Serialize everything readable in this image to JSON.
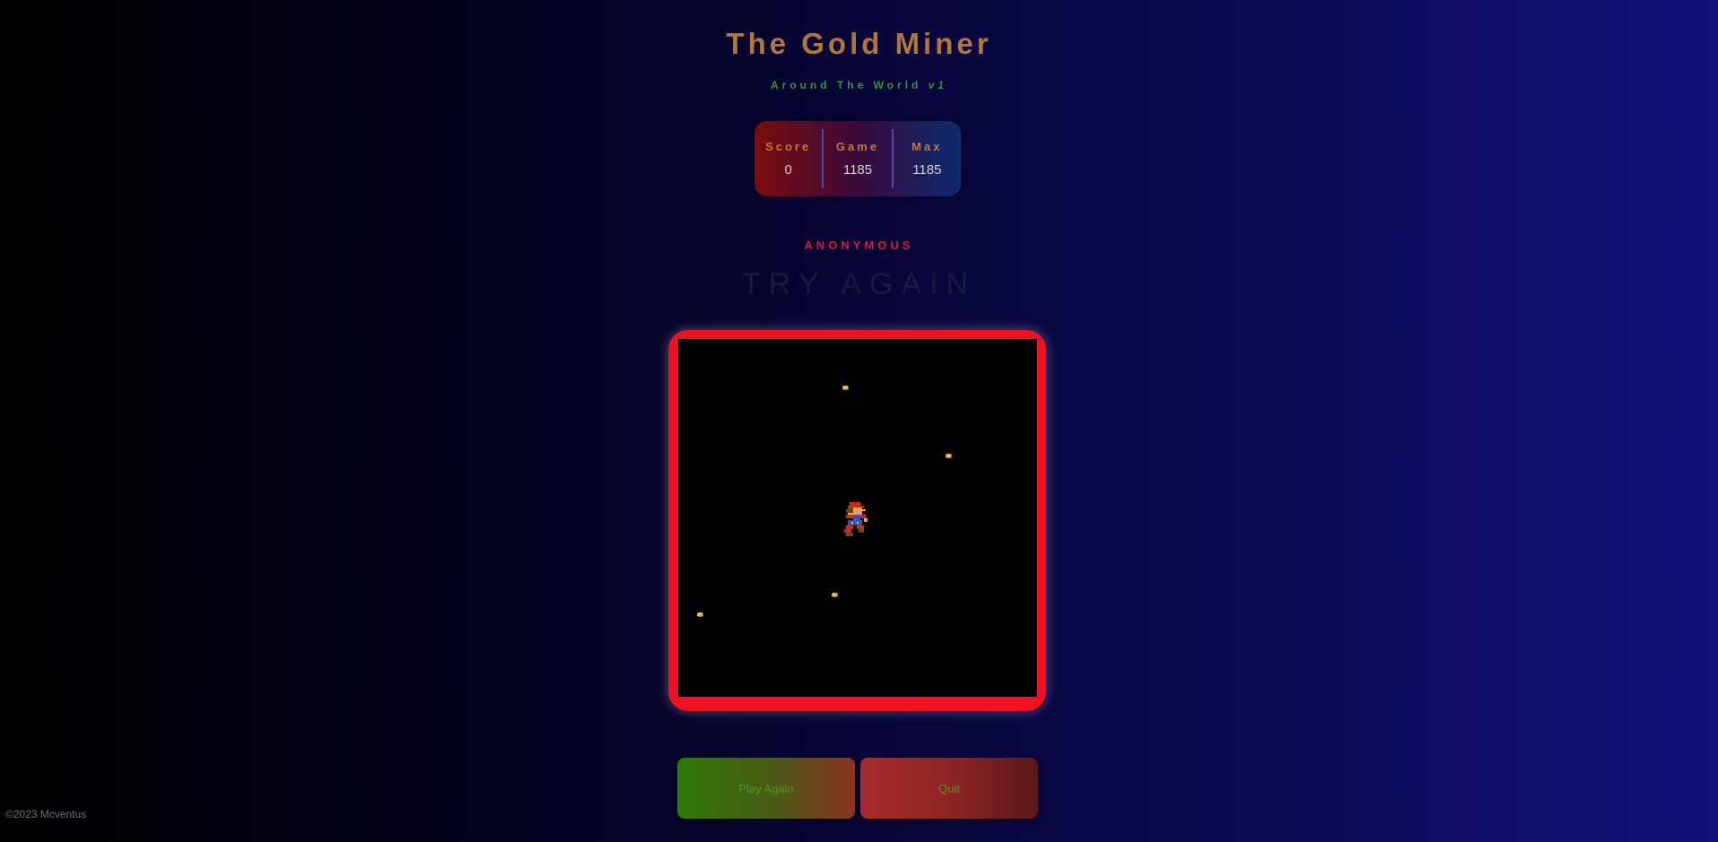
{
  "header": {
    "title": "The Gold Miner",
    "subtitle_text": "Around The World ",
    "subtitle_version": "v1"
  },
  "stats": {
    "score_label": "Score",
    "score_value": "0",
    "game_label": "Game",
    "game_value": "1185",
    "max_label": "Max",
    "max_value": "1185"
  },
  "player_name": "ANONYMOUS",
  "status_message": "TRY AGAIN",
  "board": {
    "border_color": "#f0101e",
    "gold_nuggets": 4,
    "icons": [
      "gold-nugget-icon",
      "miner-icon"
    ]
  },
  "buttons": {
    "play_again_label": "Play Again",
    "quit_label": "Quit"
  },
  "footer": "©2023 Mcventus"
}
